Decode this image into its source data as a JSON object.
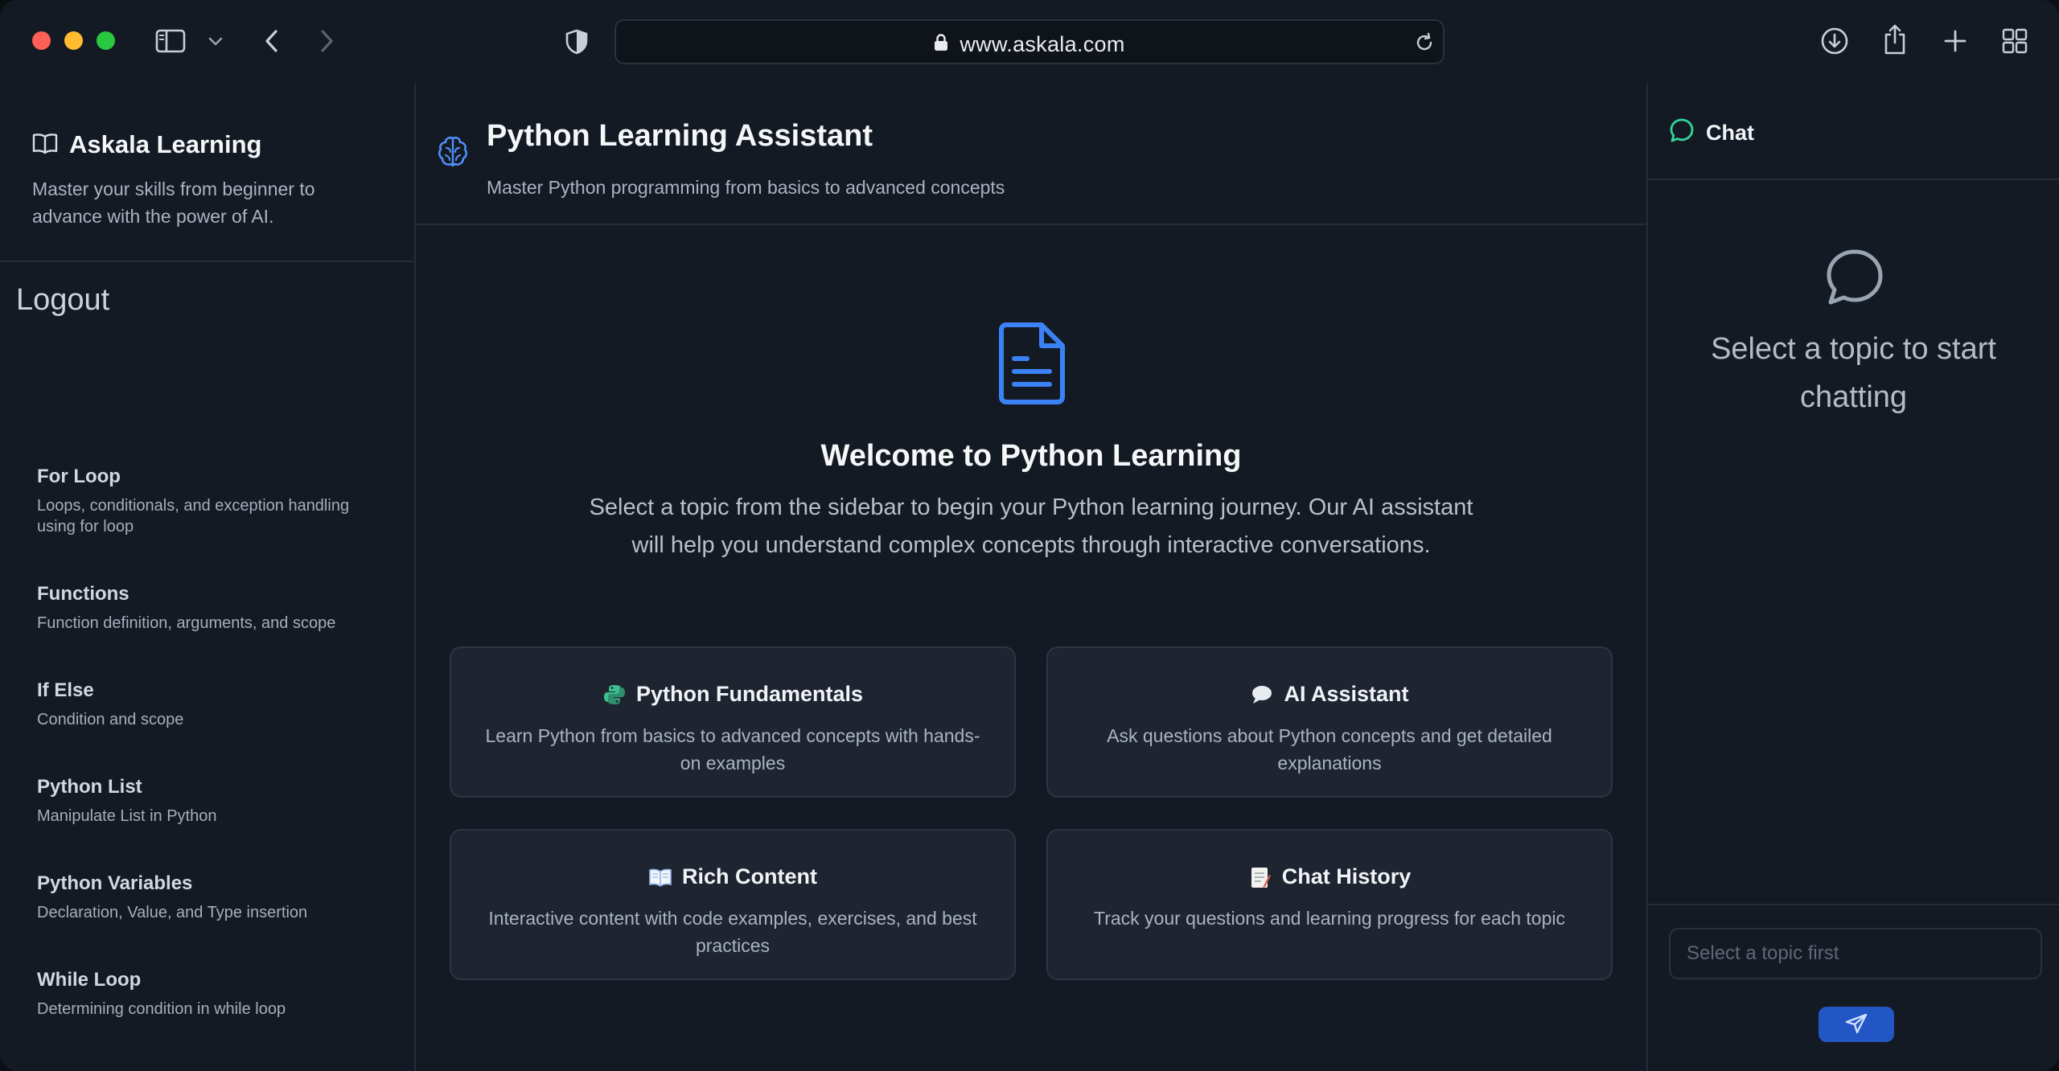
{
  "browser": {
    "url": "www.askala.com"
  },
  "sidebar": {
    "brand_title": "Askala Learning",
    "brand_description": "Master your skills from beginner to advance with the power of AI.",
    "logout_label": "Logout",
    "topics": [
      {
        "title": "For Loop",
        "description": "Loops, conditionals, and exception handling using for loop"
      },
      {
        "title": "Functions",
        "description": "Function definition, arguments, and scope"
      },
      {
        "title": "If Else",
        "description": "Condition and scope"
      },
      {
        "title": "Python List",
        "description": "Manipulate List in Python"
      },
      {
        "title": "Python Variables",
        "description": "Declaration, Value, and Type insertion"
      },
      {
        "title": "While Loop",
        "description": "Determining condition in while loop"
      }
    ]
  },
  "main": {
    "title": "Python Learning Assistant",
    "subtitle": "Master Python programming from basics to advanced concepts",
    "welcome_title": "Welcome to Python Learning",
    "welcome_text": "Select a topic from the sidebar to begin your Python learning journey. Our AI assistant will help you understand complex concepts through interactive conversations.",
    "cards": [
      {
        "icon": "python-icon",
        "title": "Python Fundamentals",
        "description": "Learn Python from basics to advanced concepts with hands-on examples"
      },
      {
        "icon": "speech-bubble-icon",
        "title": "AI Assistant",
        "description": "Ask questions about Python concepts and get detailed explanations"
      },
      {
        "icon": "book-icon",
        "title": "Rich Content",
        "description": "Interactive content with code examples, exercises, and best practices"
      },
      {
        "icon": "memo-icon",
        "title": "Chat History",
        "description": "Track your questions and learning progress for each topic"
      }
    ]
  },
  "chat": {
    "header_label": "Chat",
    "empty_message": "Select a topic to start chatting",
    "input_placeholder": "Select a topic first"
  },
  "colors": {
    "background": "#141a23",
    "card": "#1e2531",
    "accent_blue": "#3b82f6",
    "accent_green": "#34d399",
    "send_button": "#2256c4"
  }
}
